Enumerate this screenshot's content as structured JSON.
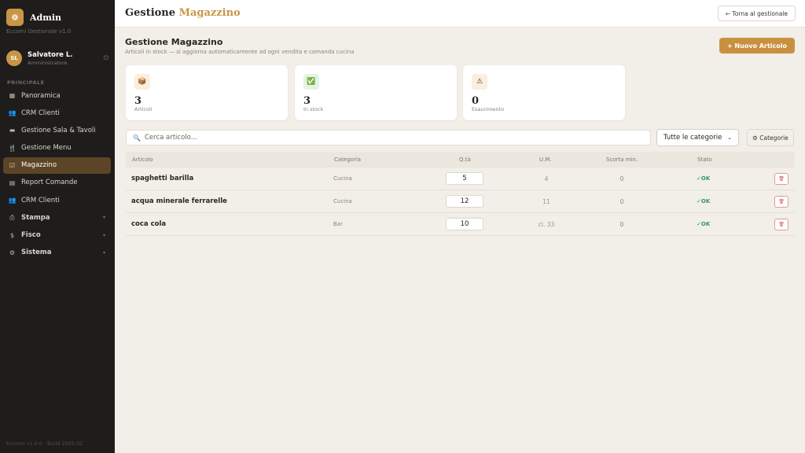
{
  "sidebar": {
    "brand_title": "Admin",
    "brand_subtitle": "Eccomi Gestionale v1.0",
    "user": {
      "initials": "SL",
      "name": "Salvatore L.",
      "role": "Amministratore"
    },
    "section_label": "PRINCIPALE",
    "items": [
      {
        "label": "Panoramica",
        "icon": "dashboard-icon",
        "glyph": "▦",
        "active": false,
        "chevron": false
      },
      {
        "label": "CRM Clienti",
        "icon": "users-icon",
        "glyph": "👥",
        "active": false,
        "chevron": false
      },
      {
        "label": "Gestione Sala & Tavoli",
        "icon": "table-icon",
        "glyph": "▬",
        "active": false,
        "chevron": false
      },
      {
        "label": "Gestione Menu",
        "icon": "cutlery-icon",
        "glyph": "🍴",
        "active": false,
        "chevron": false
      },
      {
        "label": "Magazzino",
        "icon": "warehouse-icon",
        "glyph": "☑",
        "active": true,
        "chevron": false
      },
      {
        "label": "Report Comande",
        "icon": "report-icon",
        "glyph": "▤",
        "active": false,
        "chevron": false
      },
      {
        "label": "CRM Clienti",
        "icon": "users-icon",
        "glyph": "👥",
        "active": false,
        "chevron": false
      },
      {
        "label": "Stampa",
        "icon": "printer-icon",
        "glyph": "⎙",
        "active": false,
        "chevron": true
      },
      {
        "label": "Fisco",
        "icon": "dollar-icon",
        "glyph": "$",
        "active": false,
        "chevron": true
      },
      {
        "label": "Sistema",
        "icon": "gear-icon",
        "glyph": "⚙",
        "active": false,
        "chevron": true
      }
    ],
    "footer": "Eccomi v1.0.0 · Build 2025.02"
  },
  "topbar": {
    "title_main": "Gestione",
    "title_accent": "Magazzino",
    "back_label": "← Torna al gestionale"
  },
  "main": {
    "heading": "Gestione Magazzino",
    "subheading": "Articoli in stock — si aggiorna automaticamente ad ogni vendita e comanda cucina",
    "new_button": "+ Nuovo Articolo",
    "cards": [
      {
        "value": "3",
        "label": "Articoli",
        "icon": "box-icon",
        "glyph": "📦",
        "bg": "#fbeedd"
      },
      {
        "value": "3",
        "label": "In stock",
        "icon": "check-icon",
        "glyph": "✅",
        "bg": "#e3f3e6"
      },
      {
        "value": "0",
        "label": "Esaurimento",
        "icon": "warning-icon",
        "glyph": "⚠",
        "bg": "#fbeedd"
      }
    ],
    "search_placeholder": "Cerca articolo...",
    "category_select": "Tutte le categorie",
    "category_button": "⚙ Categorie",
    "table": {
      "headers": [
        "Articolo",
        "Categoria",
        "Q.tà",
        "U.M.",
        "Scorta min.",
        "Stato"
      ],
      "rows": [
        {
          "name": "spaghetti barilla",
          "category": "Cucina",
          "qty": "5",
          "um": "4",
          "scorta": "0",
          "stato": "✓OK"
        },
        {
          "name": "acqua minerale ferrarelle",
          "category": "Cucina",
          "qty": "12",
          "um": "11",
          "scorta": "0",
          "stato": "✓OK"
        },
        {
          "name": "coca cola",
          "category": "Bar",
          "qty": "10",
          "um": "cl. 33",
          "scorta": "0",
          "stato": "✓OK"
        }
      ]
    }
  }
}
